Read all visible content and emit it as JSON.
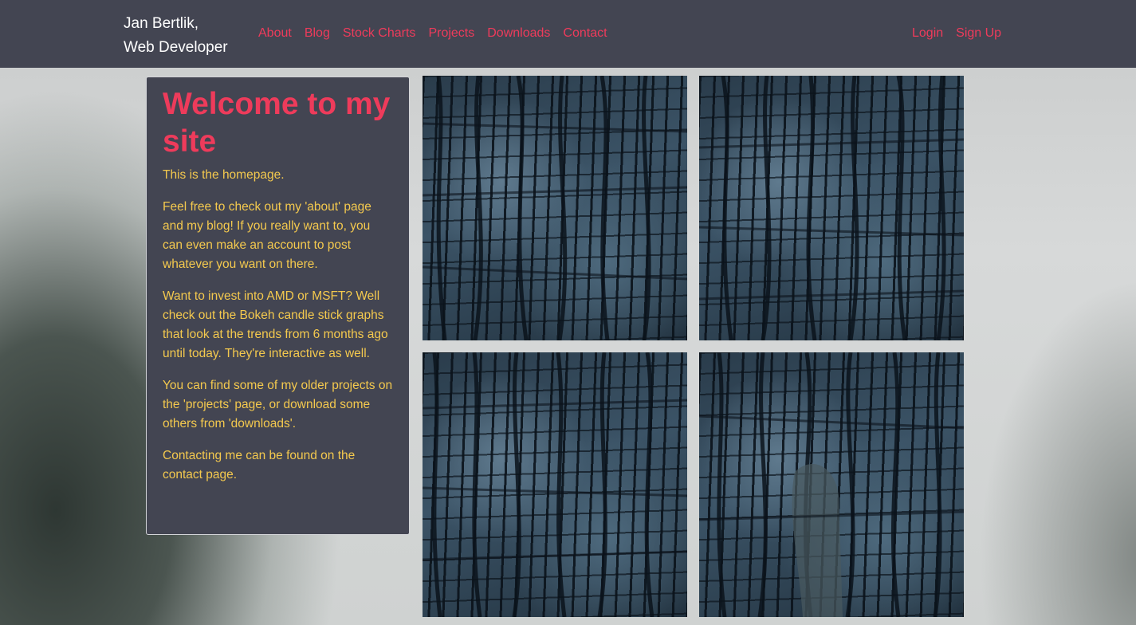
{
  "brand": {
    "line1": "Jan Bertlik,",
    "line2": "Web Developer"
  },
  "nav": {
    "links": [
      "About",
      "Blog",
      "Stock Charts",
      "Projects",
      "Downloads",
      "Contact"
    ],
    "right": [
      "Login",
      "Sign Up"
    ]
  },
  "welcome": {
    "title": "Welcome to my site",
    "paragraphs": [
      "This is the homepage.",
      "Feel free to check out my 'about' page and my blog! If you really want to, you can even make an account to post whatever you want on there.",
      "Want to invest into AMD or MSFT? Well check out the Bokeh candle stick graphs that look at the trends from 6 months ago until today. They're interactive as well.",
      "You can find some of my older projects on the 'projects' page, or download some others from 'downloads'.",
      "Contacting me can be found on the contact page."
    ]
  },
  "gallery": {
    "images": [
      "tree-bark-image",
      "tree-bark-image",
      "tree-bark-image",
      "tree-bark-image"
    ]
  },
  "colors": {
    "nav_bg": "#434552",
    "accent": "#ee3b5b",
    "body_text": "#f4c94e"
  }
}
